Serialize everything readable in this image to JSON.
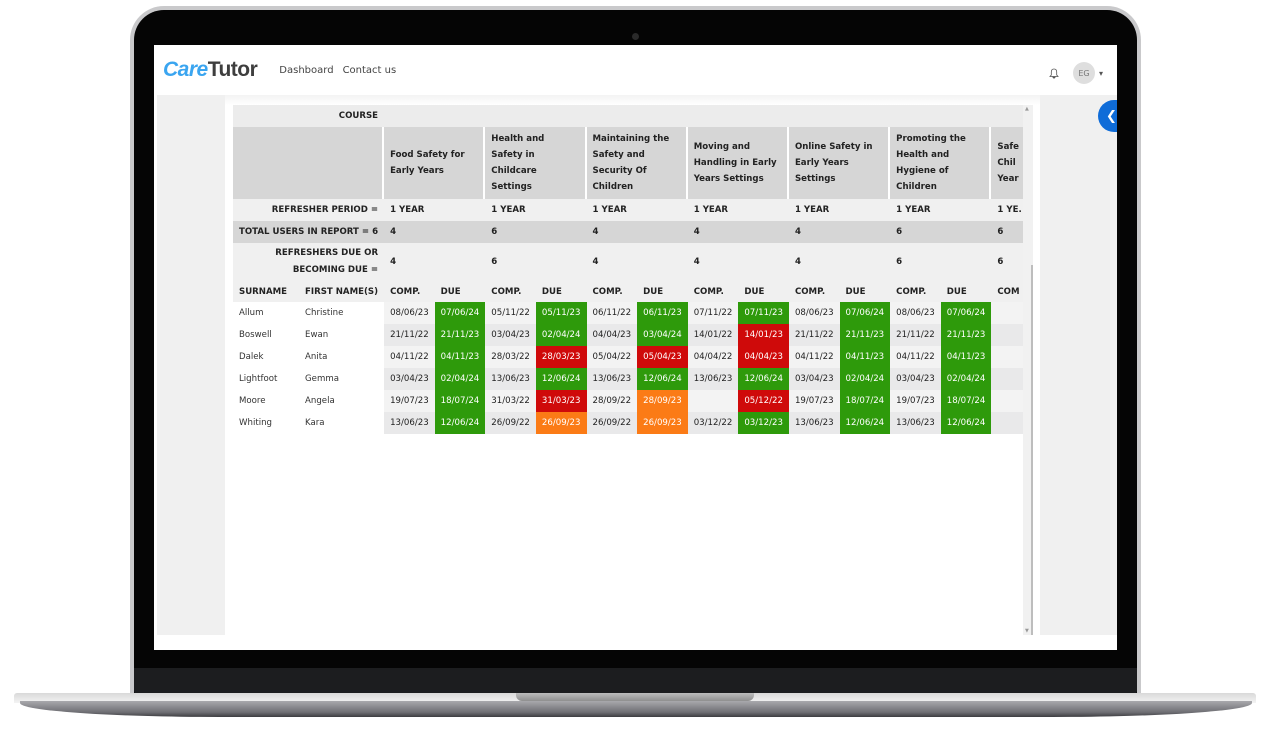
{
  "app": {
    "logo_care": "Care",
    "logo_tutor": "Tutor",
    "nav": [
      "Dashboard",
      "Contact us"
    ],
    "user_initials": "EG",
    "icons": {
      "bell": "bell-icon",
      "caret": "chevron-down-icon",
      "drawer": "chevron-left-icon"
    }
  },
  "colors": {
    "brand_blue": "#3aa5f0",
    "due_ok": "#2e9a0b",
    "overdue": "#cf0a0a",
    "due_soon": "#fb7b16",
    "drawer_button": "#0f6cd8"
  },
  "report": {
    "course_label": "COURSE",
    "refresher_label": "REFRESHER PERIOD =",
    "total_label": "TOTAL USERS IN REPORT = 6",
    "due_label": "REFRESHERS DUE OR BECOMING DUE =",
    "surname_header": "SURNAME",
    "firstname_header": "FIRST NAME(S)",
    "comp_header": "COMP.",
    "due_header": "DUE",
    "courses": [
      {
        "title": "Food Safety for Early Years",
        "refresher": "1 YEAR",
        "total": "4",
        "due": "4"
      },
      {
        "title": "Health and Safety in Childcare Settings",
        "refresher": "1 YEAR",
        "total": "6",
        "due": "6"
      },
      {
        "title": "Maintaining the Safety and Security Of Children",
        "refresher": "1 YEAR",
        "total": "4",
        "due": "4"
      },
      {
        "title": "Moving and Handling in Early Years Settings",
        "refresher": "1 YEAR",
        "total": "4",
        "due": "4"
      },
      {
        "title": "Online Safety in Early Years Settings",
        "refresher": "1 YEAR",
        "total": "4",
        "due": "4"
      },
      {
        "title": "Promoting the Health and Hygiene of Children",
        "refresher": "1 YEAR",
        "total": "6",
        "due": "6"
      },
      {
        "title": "Safe Chil Year",
        "refresher": "1 YE.",
        "total": "6",
        "due": "6",
        "truncated_comp_header": "COM"
      }
    ],
    "rows": [
      {
        "surname": "Allum",
        "first": "Christine",
        "cells": [
          [
            "08/06/23",
            "07/06/24",
            "green"
          ],
          [
            "05/11/22",
            "05/11/23",
            "green"
          ],
          [
            "06/11/22",
            "06/11/23",
            "green"
          ],
          [
            "07/11/22",
            "07/11/23",
            "green"
          ],
          [
            "08/06/23",
            "07/06/24",
            "green"
          ],
          [
            "08/06/23",
            "07/06/24",
            "green"
          ]
        ]
      },
      {
        "surname": "Boswell",
        "first": "Ewan",
        "cells": [
          [
            "21/11/22",
            "21/11/23",
            "green"
          ],
          [
            "03/04/23",
            "02/04/24",
            "green"
          ],
          [
            "04/04/23",
            "03/04/24",
            "green"
          ],
          [
            "14/01/22",
            "14/01/23",
            "red"
          ],
          [
            "21/11/22",
            "21/11/23",
            "green"
          ],
          [
            "21/11/22",
            "21/11/23",
            "green"
          ]
        ]
      },
      {
        "surname": "Dalek",
        "first": "Anita",
        "cells": [
          [
            "04/11/22",
            "04/11/23",
            "green"
          ],
          [
            "28/03/22",
            "28/03/23",
            "red"
          ],
          [
            "05/04/22",
            "05/04/23",
            "red"
          ],
          [
            "04/04/22",
            "04/04/23",
            "red"
          ],
          [
            "04/11/22",
            "04/11/23",
            "green"
          ],
          [
            "04/11/22",
            "04/11/23",
            "green"
          ]
        ]
      },
      {
        "surname": "Lightfoot",
        "first": "Gemma",
        "cells": [
          [
            "03/04/23",
            "02/04/24",
            "green"
          ],
          [
            "13/06/23",
            "12/06/24",
            "green"
          ],
          [
            "13/06/23",
            "12/06/24",
            "green"
          ],
          [
            "13/06/23",
            "12/06/24",
            "green"
          ],
          [
            "03/04/23",
            "02/04/24",
            "green"
          ],
          [
            "03/04/23",
            "02/04/24",
            "green"
          ]
        ]
      },
      {
        "surname": "Moore",
        "first": "Angela",
        "cells": [
          [
            "19/07/23",
            "18/07/24",
            "green"
          ],
          [
            "31/03/22",
            "31/03/23",
            "red"
          ],
          [
            "28/09/22",
            "28/09/23",
            "orange"
          ],
          [
            "",
            "05/12/22",
            "red"
          ],
          [
            "19/07/23",
            "18/07/24",
            "green"
          ],
          [
            "19/07/23",
            "18/07/24",
            "green"
          ]
        ]
      },
      {
        "surname": "Whiting",
        "first": "Kara",
        "cells": [
          [
            "13/06/23",
            "12/06/24",
            "green"
          ],
          [
            "26/09/22",
            "26/09/23",
            "orange"
          ],
          [
            "26/09/22",
            "26/09/23",
            "orange"
          ],
          [
            "03/12/22",
            "03/12/23",
            "green"
          ],
          [
            "13/06/23",
            "12/06/24",
            "green"
          ],
          [
            "13/06/23",
            "12/06/24",
            "green"
          ]
        ]
      }
    ]
  }
}
